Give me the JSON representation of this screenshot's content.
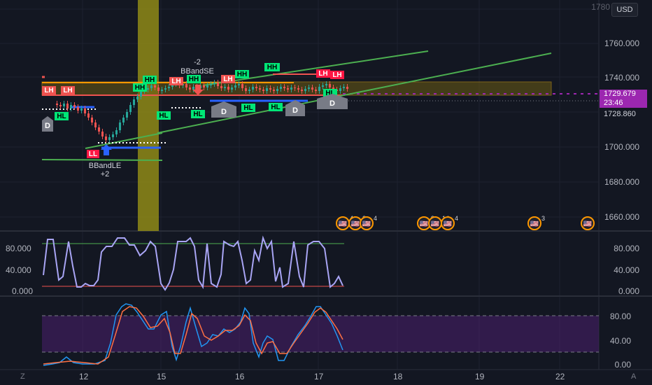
{
  "currency_button": "USD",
  "price_axis": [
    "1760.000",
    "1740.000",
    "1700.000",
    "1680.000",
    "1660.000"
  ],
  "price_top_cut": "1780",
  "current_price": "1729.679",
  "countdown": "23:46",
  "other_price": "1728.860",
  "osc1_axis": [
    "80.000",
    "40.000",
    "0.000"
  ],
  "osc1_left_axis": [
    "80.000",
    "40.000",
    "0.000"
  ],
  "osc2_axis": [
    "80.00",
    "40.00",
    "0.00"
  ],
  "time_axis": [
    "12",
    "15",
    "16",
    "17",
    "18",
    "19",
    "22"
  ],
  "corner_left": "Z",
  "corner_right": "A",
  "labels": {
    "hh": "HH",
    "hl": "HL",
    "lh": "LH",
    "ll": "LL",
    "d": "D",
    "bbandse": "BBandSE",
    "bbandse_qty": "-2",
    "bbandle": "BBandLE",
    "bbandle_qty": "+2"
  },
  "events": [
    {
      "flag": "🇺🇸",
      "count": "4"
    },
    {
      "flag": "🇺🇸",
      "count": "2"
    },
    {
      "flag": "🇺🇸",
      "count": "4"
    },
    {
      "flag": "🇺🇸",
      "count": "9"
    },
    {
      "flag": "🇺🇸",
      "count": "14"
    },
    {
      "flag": "🇺🇸",
      "count": "4"
    },
    {
      "flag": "🇺🇸",
      "count": "3"
    },
    {
      "flag": "🇺🇸",
      "count": ""
    }
  ],
  "colors": {
    "background": "#131722",
    "bull": "#26a69a",
    "bear": "#ef5350",
    "highlight_band": "#8f8a16",
    "trendline": "#4caf50",
    "purple": "#9c27b0",
    "stoch_line": "#a9a5f5",
    "k_line": "#2196f3",
    "d_line": "#ff7043"
  }
}
